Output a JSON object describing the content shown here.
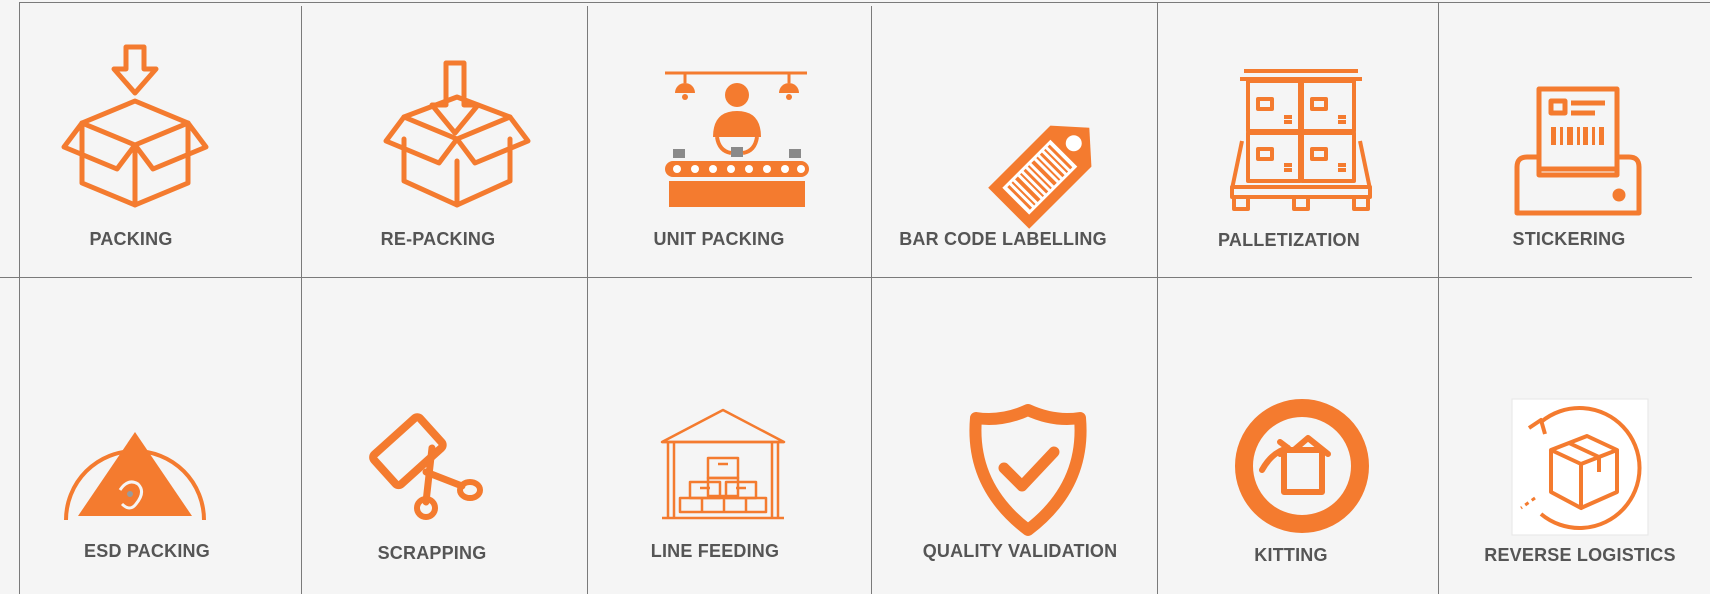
{
  "services": [
    {
      "label": "PACKING",
      "icon": "open-box-down-arrow-icon"
    },
    {
      "label": "RE-PACKING",
      "icon": "repack-box-arrow-icon"
    },
    {
      "label": "UNIT PACKING",
      "icon": "conveyor-worker-icon"
    },
    {
      "label": "BAR CODE LABELLING",
      "icon": "barcode-tag-icon"
    },
    {
      "label": "PALLETIZATION",
      "icon": "stacked-boxes-pallet-icon"
    },
    {
      "label": "STICKERING",
      "icon": "label-printer-icon"
    },
    {
      "label": "ESD PACKING",
      "icon": "esd-warning-icon"
    },
    {
      "label": "SCRAPPING",
      "icon": "cut-card-scissors-icon"
    },
    {
      "label": "LINE FEEDING",
      "icon": "warehouse-boxes-icon"
    },
    {
      "label": "QUALITY VALIDATION",
      "icon": "shield-check-icon"
    },
    {
      "label": "KITTING",
      "icon": "kitting-box-circle-icon"
    },
    {
      "label": "REVERSE LOGISTICS",
      "icon": "return-box-arrow-icon"
    }
  ],
  "colors": {
    "accent": "#f47b2f",
    "label": "#555555",
    "background": "#f5f5f5",
    "grid_lines": "#7a7a7a"
  }
}
